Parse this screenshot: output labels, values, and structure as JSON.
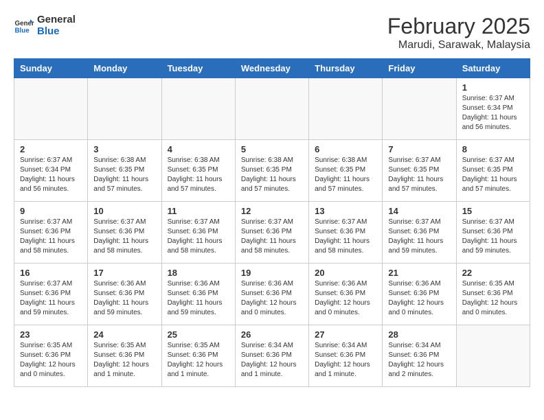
{
  "header": {
    "logo_general": "General",
    "logo_blue": "Blue",
    "month": "February 2025",
    "location": "Marudi, Sarawak, Malaysia"
  },
  "weekdays": [
    "Sunday",
    "Monday",
    "Tuesday",
    "Wednesday",
    "Thursday",
    "Friday",
    "Saturday"
  ],
  "weeks": [
    [
      {
        "day": "",
        "info": ""
      },
      {
        "day": "",
        "info": ""
      },
      {
        "day": "",
        "info": ""
      },
      {
        "day": "",
        "info": ""
      },
      {
        "day": "",
        "info": ""
      },
      {
        "day": "",
        "info": ""
      },
      {
        "day": "1",
        "info": "Sunrise: 6:37 AM\nSunset: 6:34 PM\nDaylight: 11 hours\nand 56 minutes."
      }
    ],
    [
      {
        "day": "2",
        "info": "Sunrise: 6:37 AM\nSunset: 6:34 PM\nDaylight: 11 hours\nand 56 minutes."
      },
      {
        "day": "3",
        "info": "Sunrise: 6:38 AM\nSunset: 6:35 PM\nDaylight: 11 hours\nand 57 minutes."
      },
      {
        "day": "4",
        "info": "Sunrise: 6:38 AM\nSunset: 6:35 PM\nDaylight: 11 hours\nand 57 minutes."
      },
      {
        "day": "5",
        "info": "Sunrise: 6:38 AM\nSunset: 6:35 PM\nDaylight: 11 hours\nand 57 minutes."
      },
      {
        "day": "6",
        "info": "Sunrise: 6:38 AM\nSunset: 6:35 PM\nDaylight: 11 hours\nand 57 minutes."
      },
      {
        "day": "7",
        "info": "Sunrise: 6:37 AM\nSunset: 6:35 PM\nDaylight: 11 hours\nand 57 minutes."
      },
      {
        "day": "8",
        "info": "Sunrise: 6:37 AM\nSunset: 6:35 PM\nDaylight: 11 hours\nand 57 minutes."
      }
    ],
    [
      {
        "day": "9",
        "info": "Sunrise: 6:37 AM\nSunset: 6:36 PM\nDaylight: 11 hours\nand 58 minutes."
      },
      {
        "day": "10",
        "info": "Sunrise: 6:37 AM\nSunset: 6:36 PM\nDaylight: 11 hours\nand 58 minutes."
      },
      {
        "day": "11",
        "info": "Sunrise: 6:37 AM\nSunset: 6:36 PM\nDaylight: 11 hours\nand 58 minutes."
      },
      {
        "day": "12",
        "info": "Sunrise: 6:37 AM\nSunset: 6:36 PM\nDaylight: 11 hours\nand 58 minutes."
      },
      {
        "day": "13",
        "info": "Sunrise: 6:37 AM\nSunset: 6:36 PM\nDaylight: 11 hours\nand 58 minutes."
      },
      {
        "day": "14",
        "info": "Sunrise: 6:37 AM\nSunset: 6:36 PM\nDaylight: 11 hours\nand 59 minutes."
      },
      {
        "day": "15",
        "info": "Sunrise: 6:37 AM\nSunset: 6:36 PM\nDaylight: 11 hours\nand 59 minutes."
      }
    ],
    [
      {
        "day": "16",
        "info": "Sunrise: 6:37 AM\nSunset: 6:36 PM\nDaylight: 11 hours\nand 59 minutes."
      },
      {
        "day": "17",
        "info": "Sunrise: 6:36 AM\nSunset: 6:36 PM\nDaylight: 11 hours\nand 59 minutes."
      },
      {
        "day": "18",
        "info": "Sunrise: 6:36 AM\nSunset: 6:36 PM\nDaylight: 11 hours\nand 59 minutes."
      },
      {
        "day": "19",
        "info": "Sunrise: 6:36 AM\nSunset: 6:36 PM\nDaylight: 12 hours\nand 0 minutes."
      },
      {
        "day": "20",
        "info": "Sunrise: 6:36 AM\nSunset: 6:36 PM\nDaylight: 12 hours\nand 0 minutes."
      },
      {
        "day": "21",
        "info": "Sunrise: 6:36 AM\nSunset: 6:36 PM\nDaylight: 12 hours\nand 0 minutes."
      },
      {
        "day": "22",
        "info": "Sunrise: 6:35 AM\nSunset: 6:36 PM\nDaylight: 12 hours\nand 0 minutes."
      }
    ],
    [
      {
        "day": "23",
        "info": "Sunrise: 6:35 AM\nSunset: 6:36 PM\nDaylight: 12 hours\nand 0 minutes."
      },
      {
        "day": "24",
        "info": "Sunrise: 6:35 AM\nSunset: 6:36 PM\nDaylight: 12 hours\nand 1 minute."
      },
      {
        "day": "25",
        "info": "Sunrise: 6:35 AM\nSunset: 6:36 PM\nDaylight: 12 hours\nand 1 minute."
      },
      {
        "day": "26",
        "info": "Sunrise: 6:34 AM\nSunset: 6:36 PM\nDaylight: 12 hours\nand 1 minute."
      },
      {
        "day": "27",
        "info": "Sunrise: 6:34 AM\nSunset: 6:36 PM\nDaylight: 12 hours\nand 1 minute."
      },
      {
        "day": "28",
        "info": "Sunrise: 6:34 AM\nSunset: 6:36 PM\nDaylight: 12 hours\nand 2 minutes."
      },
      {
        "day": "",
        "info": ""
      }
    ]
  ]
}
